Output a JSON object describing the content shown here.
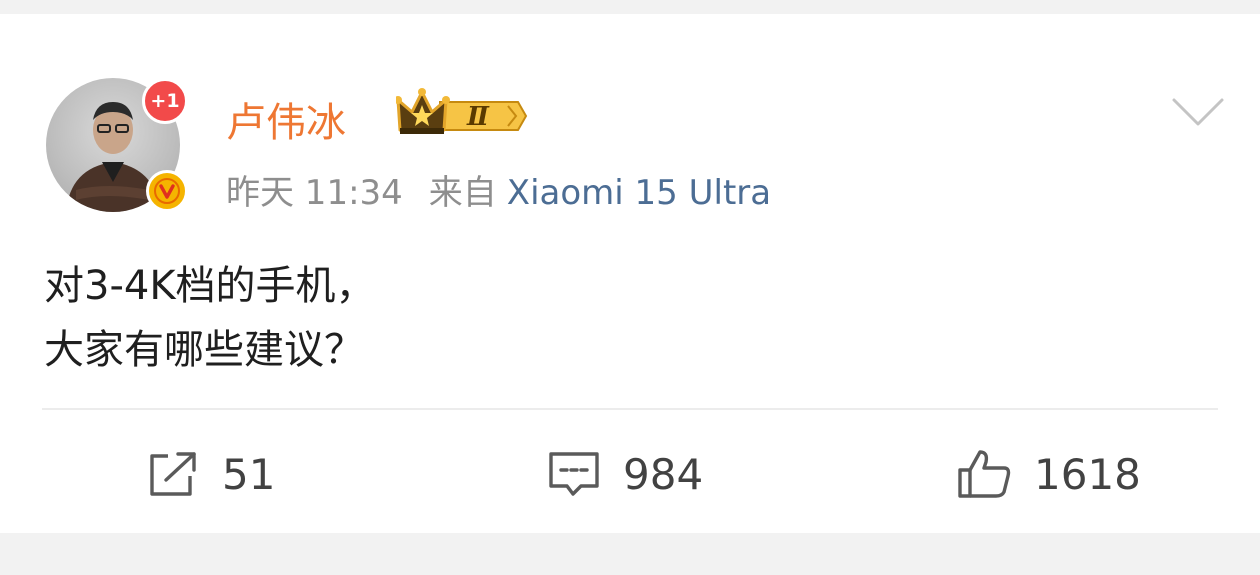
{
  "post": {
    "author": "卢伟冰",
    "notif_badge": "+1",
    "vip_level": "Ⅱ",
    "time": "昨天 11:34",
    "from_label": "来自",
    "device": "Xiaomi 15 Ultra",
    "content_line1": "对3-4K档的手机，",
    "content_line2": "大家有哪些建议？"
  },
  "actions": {
    "repost_count": "51",
    "comment_count": "984",
    "like_count": "1618"
  },
  "colors": {
    "username": "#ee7733",
    "device_link": "#4c6d94",
    "notif_badge": "#f24a4a",
    "verify_badge": "#f5b400"
  },
  "icons": {
    "repost": "repost-icon",
    "comment": "comment-icon",
    "like": "thumbs-up-icon",
    "more": "chevron-down-icon",
    "verified": "verified-v-icon",
    "vip": "crown-icon"
  }
}
